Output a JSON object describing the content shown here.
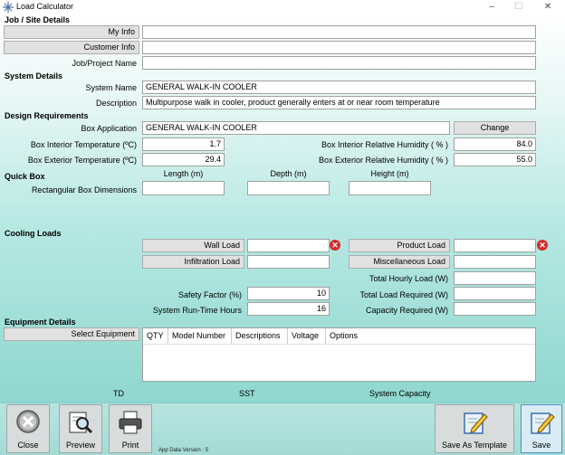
{
  "window": {
    "title": "Load Calculator",
    "minimize": "–",
    "maximize": "☐",
    "close": "✕"
  },
  "job": {
    "section": "Job / Site Details",
    "my_info_label": "My Info",
    "my_info_value": "",
    "customer_info_label": "Customer Info",
    "customer_info_value": "",
    "job_name_label": "Job/Project Name",
    "job_name_value": ""
  },
  "system": {
    "section": "System Details",
    "name_label": "System Name",
    "name_value": "GENERAL WALK-IN COOLER",
    "desc_label": "Description",
    "desc_value": "Multipurpose walk in cooler, product generally enters at or near room temperature"
  },
  "design": {
    "section": "Design Requirements",
    "box_app_label": "Box Application",
    "box_app_value": "GENERAL WALK-IN COOLER",
    "change_label": "Change",
    "int_temp_label": "Box Interior Temperature (ºC)",
    "int_temp_value": "1.7",
    "ext_temp_label": "Box Exterior Temperature (ºC)",
    "ext_temp_value": "29.4",
    "int_rh_label": "Box Interior Relative Humidity ( % )",
    "int_rh_value": "84.0",
    "ext_rh_label": "Box Exterior Relative Humidity ( % )",
    "ext_rh_value": "55.0"
  },
  "quickbox": {
    "section": "Quick Box",
    "length_label": "Length  (m)",
    "depth_label": "Depth  (m)",
    "height_label": "Height  (m)",
    "dims_label": "Rectangular Box Dimensions",
    "length_value": "",
    "depth_value": "",
    "height_value": ""
  },
  "cooling": {
    "section": "Cooling Loads",
    "wall_label": "Wall Load",
    "wall_value": "",
    "infil_label": "Infiltration Load",
    "infil_value": "",
    "product_label": "Product Load",
    "product_value": "",
    "misc_label": "Miscellaneous Load",
    "misc_value": "",
    "hourly_label": "Total Hourly Load (W)",
    "hourly_value": "",
    "safety_label": "Safety Factor (%)",
    "safety_value": "10",
    "total_req_label": "Total Load Required (W)",
    "total_req_value": "",
    "runtime_label": "System Run-Time Hours",
    "runtime_value": "16",
    "capacity_label": "Capacity Required (W)",
    "capacity_value": "",
    "x_glyph": "✕"
  },
  "equipment": {
    "section": "Equipment Details",
    "select_label": "Select Equipment",
    "columns": [
      "QTY",
      "Model Number",
      "Descriptions",
      "Voltage",
      "Options"
    ],
    "td_label": "TD",
    "sst_label": "SST",
    "capacity_label": "System Capacity"
  },
  "toolbar": {
    "close": "Close",
    "preview": "Preview",
    "print": "Print",
    "save_template": "Save As Template",
    "save": "Save",
    "version": "App Data Version : 5"
  }
}
